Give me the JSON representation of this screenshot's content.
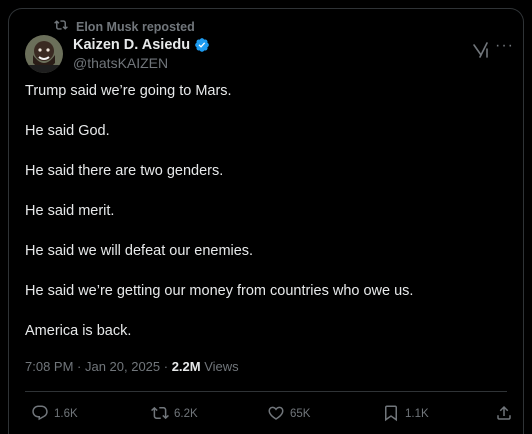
{
  "repost": {
    "icon": "repost-icon",
    "text": "Elon Musk reposted"
  },
  "author": {
    "name": "Kaizen D. Asiedu",
    "handle": "@thatsKAIZEN",
    "verified_color": "#1d9bf0"
  },
  "body": {
    "lines": [
      "Trump said we’re going to Mars.",
      "He said God.",
      "He said there are two genders.",
      "He said merit.",
      "He said we will defeat our enemies.",
      "He said we’re getting our money from countries who owe us.",
      "America is back."
    ]
  },
  "meta": {
    "timestamp": "7:08 PM · Jan 20, 2025 · ",
    "views_count": "2.2M",
    "views_label": " Views"
  },
  "actions": {
    "replies": "1.6K",
    "reposts": "6.2K",
    "likes": "65K",
    "bookmarks": "1.1K"
  },
  "colors": {
    "background": "#000000",
    "text": "#e7e9ea",
    "muted": "#71767b",
    "border": "#2f3336",
    "accent": "#1d9bf0"
  }
}
